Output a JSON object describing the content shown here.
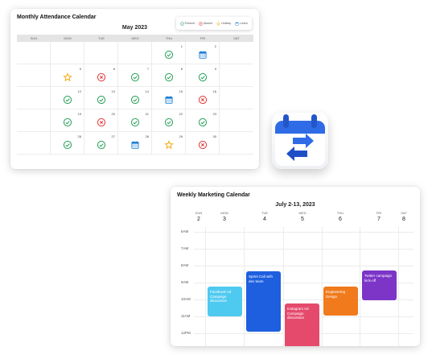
{
  "attendance": {
    "title": "Monthly Attendance Calendar",
    "month": "May 2023",
    "legend": [
      {
        "label": "Present",
        "icon": "check-icon",
        "color": "#27a05a"
      },
      {
        "label": "Absent",
        "icon": "cross-icon",
        "color": "#e0393e"
      },
      {
        "label": "Holiday",
        "icon": "star-icon",
        "color": "#f0a500"
      },
      {
        "label": "Leave",
        "icon": "calendar-icon",
        "color": "#1e7fd6"
      }
    ],
    "days": [
      "SUN",
      "MON",
      "TUE",
      "WED",
      "THU",
      "FRI",
      "SAT"
    ],
    "cells": [
      {
        "n": "",
        "s": ""
      },
      {
        "n": "",
        "s": ""
      },
      {
        "n": "",
        "s": ""
      },
      {
        "n": "",
        "s": ""
      },
      {
        "n": "1",
        "s": "present"
      },
      {
        "n": "2",
        "s": "leave"
      },
      {
        "n": "",
        "s": ""
      },
      {
        "n": "",
        "s": ""
      },
      {
        "n": "5",
        "s": "holiday"
      },
      {
        "n": "6",
        "s": "absent"
      },
      {
        "n": "7",
        "s": "present"
      },
      {
        "n": "8",
        "s": "present"
      },
      {
        "n": "9",
        "s": "present"
      },
      {
        "n": "",
        "s": ""
      },
      {
        "n": "",
        "s": ""
      },
      {
        "n": "12",
        "s": "present"
      },
      {
        "n": "13",
        "s": "present"
      },
      {
        "n": "14",
        "s": "present"
      },
      {
        "n": "15",
        "s": "leave"
      },
      {
        "n": "16",
        "s": "absent"
      },
      {
        "n": "",
        "s": ""
      },
      {
        "n": "",
        "s": ""
      },
      {
        "n": "19",
        "s": "present"
      },
      {
        "n": "20",
        "s": "absent"
      },
      {
        "n": "21",
        "s": "present"
      },
      {
        "n": "22",
        "s": "present"
      },
      {
        "n": "23",
        "s": "present"
      },
      {
        "n": "",
        "s": ""
      },
      {
        "n": "",
        "s": ""
      },
      {
        "n": "26",
        "s": "present"
      },
      {
        "n": "27",
        "s": "present"
      },
      {
        "n": "28",
        "s": "leave"
      },
      {
        "n": "29",
        "s": "holiday"
      },
      {
        "n": "30",
        "s": "absent"
      },
      {
        "n": "",
        "s": ""
      }
    ]
  },
  "tile": {
    "icon": "calendar-sync-icon"
  },
  "weekly": {
    "title": "Weekly Marketing Calendar",
    "range": "July 2-13, 2023",
    "days": [
      {
        "name": "SUN",
        "date": "2"
      },
      {
        "name": "MON",
        "date": "3"
      },
      {
        "name": "TUE",
        "date": "4"
      },
      {
        "name": "WED",
        "date": "5"
      },
      {
        "name": "THU",
        "date": "6"
      },
      {
        "name": "FRI",
        "date": "7"
      },
      {
        "name": "SAT",
        "date": "8"
      }
    ],
    "times": [
      "6AM",
      "7AM",
      "8AM",
      "9AM",
      "10AM",
      "11AM",
      "12PM"
    ],
    "events": [
      {
        "label": "Facebook Ad Campaign discussion",
        "color": "#4ec9f0"
      },
      {
        "label": "Sprint Call with dev team",
        "color": "#1e5fe0"
      },
      {
        "label": "Instagram Ad Campaign discussion",
        "color": "#e54a6c"
      },
      {
        "label": "Engineering Design",
        "color": "#f07a1c"
      },
      {
        "label": "Twitter campaign kick-off",
        "color": "#7d35c8"
      }
    ]
  }
}
